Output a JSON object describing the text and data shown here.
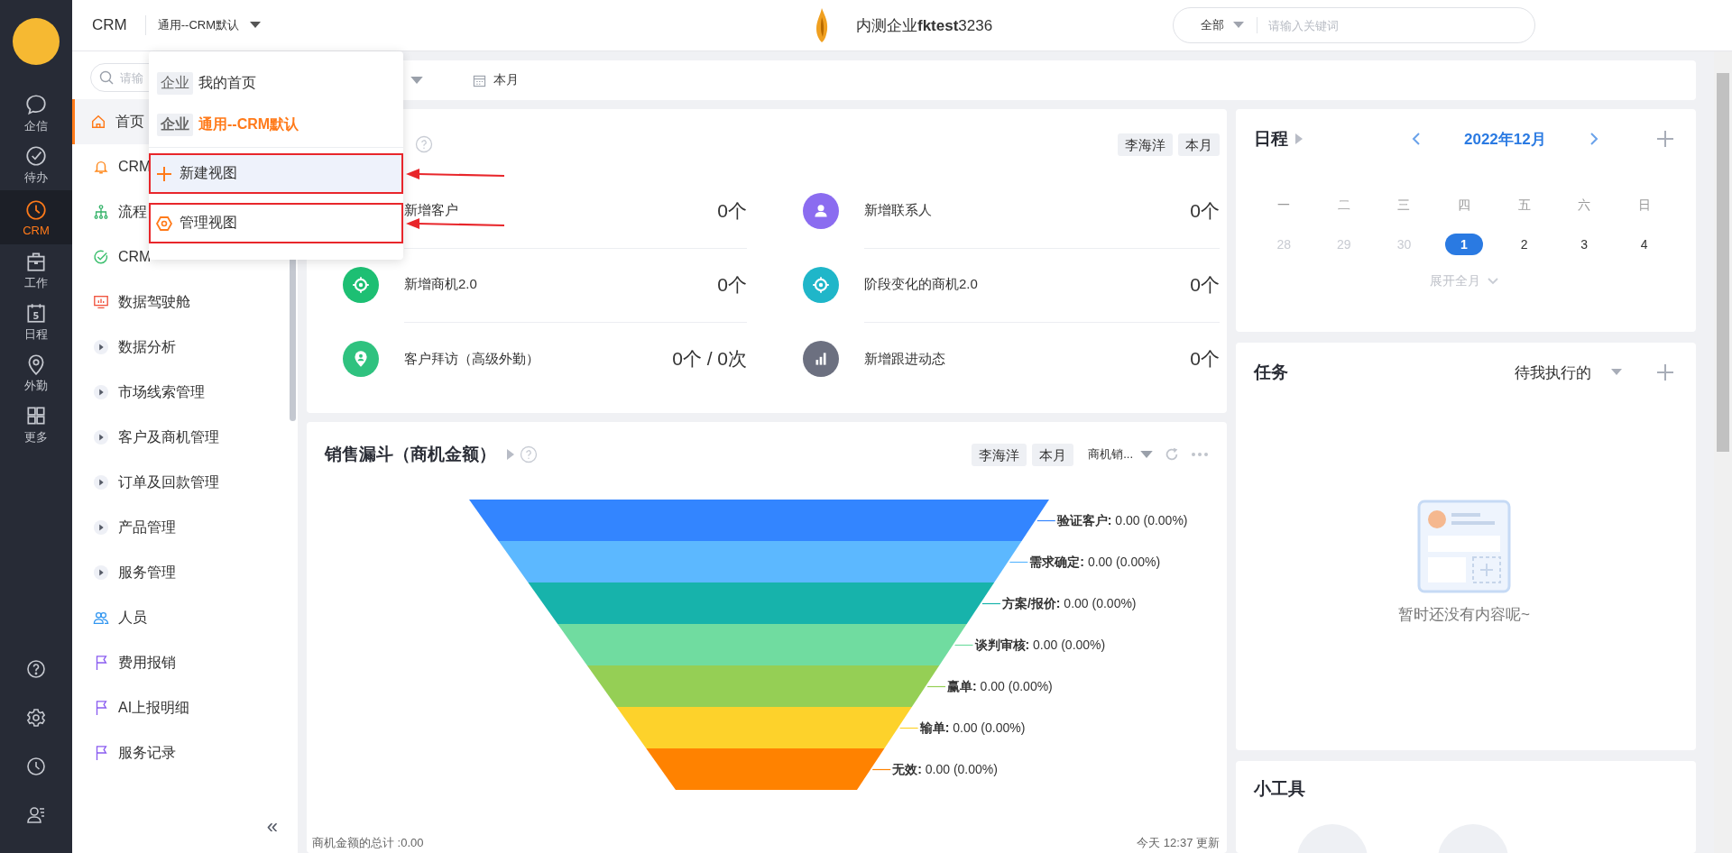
{
  "rail": {
    "items": [
      {
        "label": "企信",
        "kind": "chat",
        "selected": false
      },
      {
        "label": "待办",
        "kind": "check",
        "selected": false
      },
      {
        "label": "CRM",
        "kind": "clock",
        "selected": true
      },
      {
        "label": "工作",
        "kind": "briefcase",
        "selected": false
      },
      {
        "label": "日程",
        "kind": "calendar",
        "selected": false,
        "icon_text": "5"
      },
      {
        "label": "外勤",
        "kind": "pin",
        "selected": false
      },
      {
        "label": "更多",
        "kind": "grid",
        "selected": false
      }
    ],
    "bottom": [
      {
        "kind": "help"
      },
      {
        "kind": "settings"
      },
      {
        "kind": "clock"
      },
      {
        "kind": "contacts"
      }
    ]
  },
  "header": {
    "app": "CRM",
    "view": "通用--CRM默认",
    "company": "内测企业**fktest**3236",
    "search": {
      "scope": "全部",
      "placeholder": "请输入关键词"
    }
  },
  "sidebar": {
    "search_placeholder": "请输",
    "items": [
      {
        "label": "首页",
        "kind": "home",
        "selected": true
      },
      {
        "label": "CRM",
        "kind": "bell",
        "selected": false
      },
      {
        "label": "流程",
        "kind": "org",
        "selected": false
      },
      {
        "label": "CRM",
        "kind": "check",
        "selected": false
      },
      {
        "label": "数据驾驶舱",
        "kind": "dashboard",
        "selected": false
      },
      {
        "label": "数据分析",
        "kind": "expander",
        "selected": false
      },
      {
        "label": "市场线索管理",
        "kind": "expander",
        "selected": false
      },
      {
        "label": "客户及商机管理",
        "kind": "expander",
        "selected": false
      },
      {
        "label": "订单及回款管理",
        "kind": "expander",
        "selected": false
      },
      {
        "label": "产品管理",
        "kind": "expander",
        "selected": false
      },
      {
        "label": "服务管理",
        "kind": "expander",
        "selected": false
      },
      {
        "label": "人员",
        "kind": "people",
        "selected": false
      },
      {
        "label": "费用报销",
        "kind": "flag",
        "selected": false
      },
      {
        "label": "AI上报明细",
        "kind": "flag",
        "selected": false
      },
      {
        "label": "服务记录",
        "kind": "flag",
        "selected": false
      }
    ],
    "collapse": "«"
  },
  "toolbar": {
    "period": "本月"
  },
  "view_menu": {
    "views": [
      {
        "tag": "企业",
        "label": "我的首页",
        "selected": false
      },
      {
        "tag": "企业",
        "label": "通用--CRM默认",
        "selected": true
      }
    ],
    "actions": [
      {
        "kind": "add",
        "label": "新建视图",
        "highlighted": true,
        "annotated": true
      },
      {
        "kind": "manage",
        "label": "管理视图",
        "highlighted": false,
        "annotated": true
      }
    ]
  },
  "stats_card": {
    "filters": [
      "李海洋",
      "本月"
    ],
    "stats": [
      {
        "label": "新增客户",
        "value": "0个"
      },
      {
        "label": "新增联系人",
        "value": "0个",
        "kind": "person",
        "color": "#8b6cf0"
      },
      {
        "label": "新增商机2.0",
        "value": "0个",
        "kind": "target",
        "color": "#1dbf73"
      },
      {
        "label": "阶段变化的商机2.0",
        "value": "0个",
        "kind": "target",
        "color": "#1fb6c9"
      },
      {
        "label": "客户拜访（高级外勤）",
        "value": "0个 / 0次",
        "kind": "pin",
        "color": "#2fc27f"
      },
      {
        "label": "新增跟进动态",
        "value": "0个",
        "kind": "bars",
        "color": "#6c7080"
      }
    ]
  },
  "funnel_card": {
    "title": "销售漏斗（商机金额）",
    "filters": [
      "李海洋",
      "本月"
    ],
    "measure": "商机销...",
    "stages": [
      {
        "label": "**验证客户:** 0.00 (0.00%)",
        "color": "#3385ff"
      },
      {
        "label": "**需求确定:** 0.00 (0.00%)",
        "color": "#5cb8ff"
      },
      {
        "label": "**方案/报价:** 0.00 (0.00%)",
        "color": "#17b3ab"
      },
      {
        "label": "**谈判审核:** 0.00 (0.00%)",
        "color": "#70dca0"
      },
      {
        "label": "**赢单:** 0.00 (0.00%)",
        "color": "#95cf55"
      },
      {
        "label": "**输单:** 0.00 (0.00%)",
        "color": "#fdd22b"
      },
      {
        "label": "**无效:** 0.00 (0.00%)",
        "color": "#ff8200"
      }
    ],
    "total": "商机金额的总计 :0.00",
    "updated": "今天 12:37 更新"
  },
  "schedule": {
    "title": "日程",
    "month": "2022年12月",
    "weekdays": [
      "一",
      "二",
      "三",
      "四",
      "五",
      "六",
      "日"
    ],
    "dates": [
      {
        "text": "28",
        "in_month": false,
        "selected": false
      },
      {
        "text": "29",
        "in_month": false,
        "selected": false
      },
      {
        "text": "30",
        "in_month": false,
        "selected": false
      },
      {
        "text": "1",
        "in_month": true,
        "selected": true
      },
      {
        "text": "2",
        "in_month": true,
        "selected": false
      },
      {
        "text": "3",
        "in_month": true,
        "selected": false
      },
      {
        "text": "4",
        "in_month": true,
        "selected": false
      }
    ],
    "expand": "展开全月"
  },
  "tasks": {
    "title": "任务",
    "filter": "待我执行的",
    "empty": "暂时还没有内容呢~"
  },
  "widgets": {
    "title": "小工具"
  }
}
